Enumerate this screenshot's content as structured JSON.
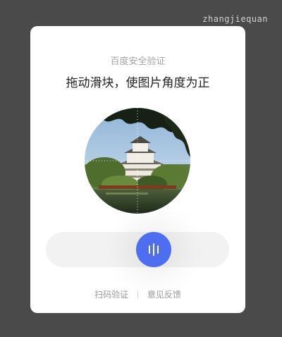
{
  "watermark": "zhangjiequan",
  "captcha": {
    "subtitle": "百度安全验证",
    "title": "拖动滑块，使图片角度为正",
    "slider": {
      "progress": 0.61
    },
    "footer": {
      "scan_label": "扫码验证",
      "feedback_label": "意见反馈"
    }
  },
  "colors": {
    "background": "#4a4a4a",
    "card": "#ffffff",
    "accent": "#4e6ef2",
    "track": "#f2f2f2"
  }
}
